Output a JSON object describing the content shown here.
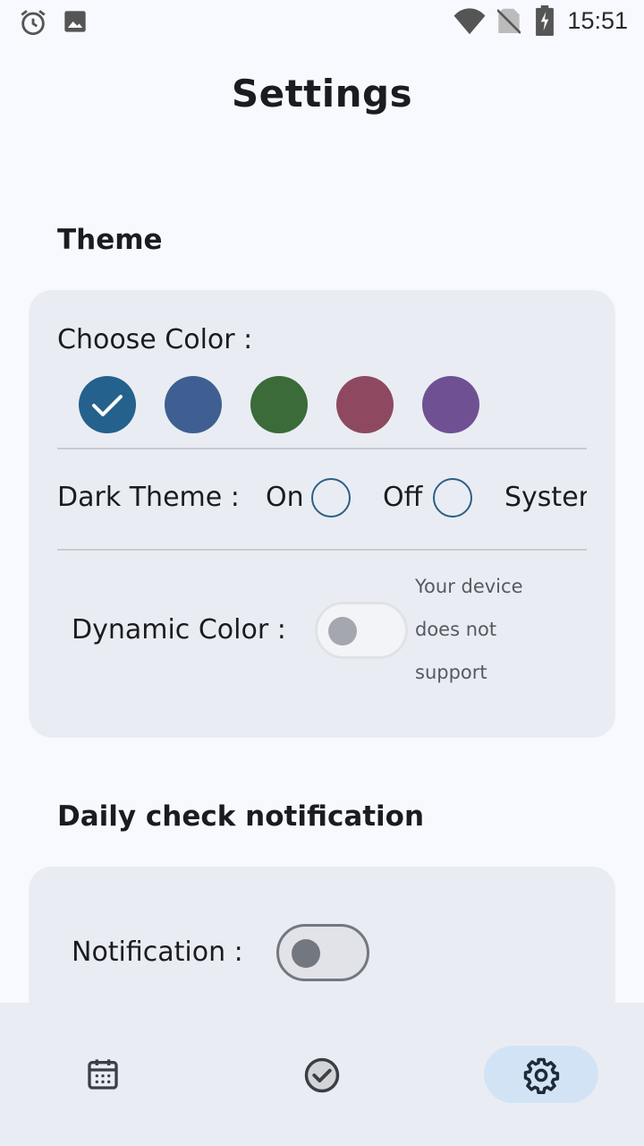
{
  "status_bar": {
    "time": "15:51",
    "icons": [
      "alarm-icon",
      "image-icon",
      "wifi-icon",
      "no-sim-icon",
      "battery-charging-icon"
    ]
  },
  "page": {
    "title": "Settings"
  },
  "theme": {
    "section_title": "Theme",
    "choose_color_label": "Choose Color :",
    "colors": [
      "#24618d",
      "#3f5f92",
      "#3b6b38",
      "#8e4960",
      "#6f5193"
    ],
    "selected_color_index": 0,
    "dark_theme": {
      "label": "Dark Theme :",
      "on_label": "On",
      "off_label": "Off",
      "system_label": "Syster"
    },
    "dynamic_color": {
      "label": "Dynamic Color :",
      "note_line1": "Your device",
      "note_line2": "does not",
      "note_line3": "support",
      "enabled": false
    }
  },
  "notification": {
    "section_title": "Daily check notification",
    "label": "Notification :",
    "enabled": false
  },
  "bottom_nav": {
    "items": [
      "calendar-icon",
      "check-circle-icon",
      "settings-icon"
    ],
    "active_index": 2
  }
}
